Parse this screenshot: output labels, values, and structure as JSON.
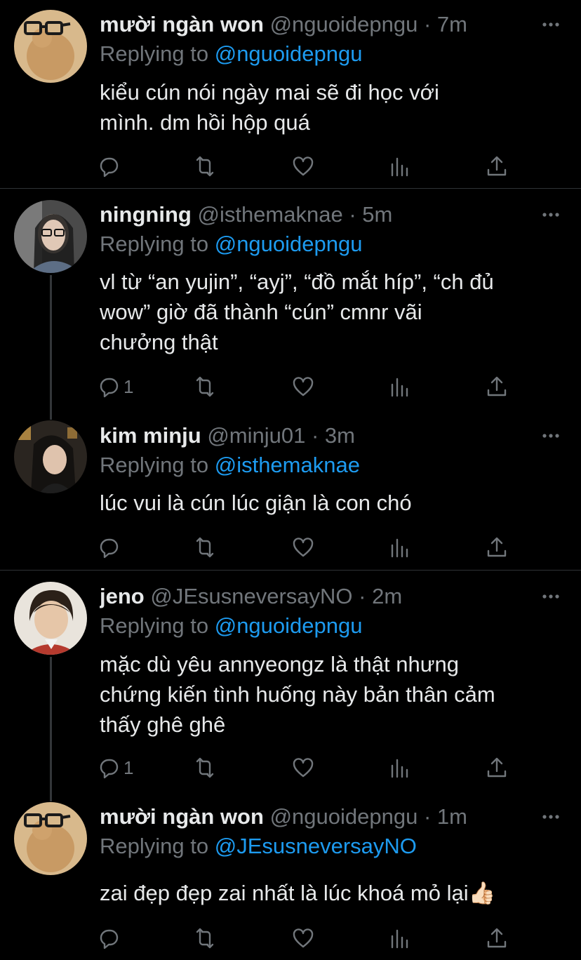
{
  "colors": {
    "background": "#000000",
    "text": "#e7e9ea",
    "secondary": "#71767b",
    "link": "#1d9bf0",
    "divider": "#2f3336"
  },
  "icons": {
    "reply": "comment-icon",
    "retweet": "retweet-icon",
    "like": "heart-icon",
    "views": "analytics-icon",
    "share": "share-icon",
    "more": "more-icon"
  },
  "tweets": [
    {
      "name": "mười ngàn won",
      "handle": "@nguoidepngu · 7m",
      "replying_label": "Replying to",
      "replying_to": "@nguoidepngu",
      "text": "kiểu cún nói ngày mai sẽ đi học với\nmình. dm hồi hộp quá",
      "reply_count": ""
    },
    {
      "name": "ningning",
      "handle": "@isthemaknae · 5m",
      "replying_label": "Replying to",
      "replying_to": "@nguoidepngu",
      "text": "vl từ “an yujin”, “ayj”, “đồ mắt híp”, “ch đủ\nwow” giờ đã thành “cún” cmnr vãi\nchưởng thật",
      "reply_count": "1"
    },
    {
      "name": "kim minju",
      "handle": "@minju01 · 3m",
      "replying_label": "Replying to",
      "replying_to": "@isthemaknae",
      "text": "lúc vui là cún lúc giận là con chó",
      "reply_count": ""
    },
    {
      "name": "jeno",
      "handle": "@JEsusneversayNO · 2m",
      "replying_label": "Replying to",
      "replying_to": "@nguoidepngu",
      "text": "mặc dù yêu annyeongz là thật nhưng\nchứng kiến tình huống này bản thân cảm\nthấy ghê ghê",
      "reply_count": "1"
    },
    {
      "name": "mười ngàn won",
      "handle": "@nguoidepngu · 1m",
      "replying_label": "Replying to",
      "replying_to": "@JEsusneversayNO",
      "text": "zai đẹp đẹp zai nhất là lúc khoá mỏ lại👍🏻",
      "reply_count": ""
    }
  ]
}
